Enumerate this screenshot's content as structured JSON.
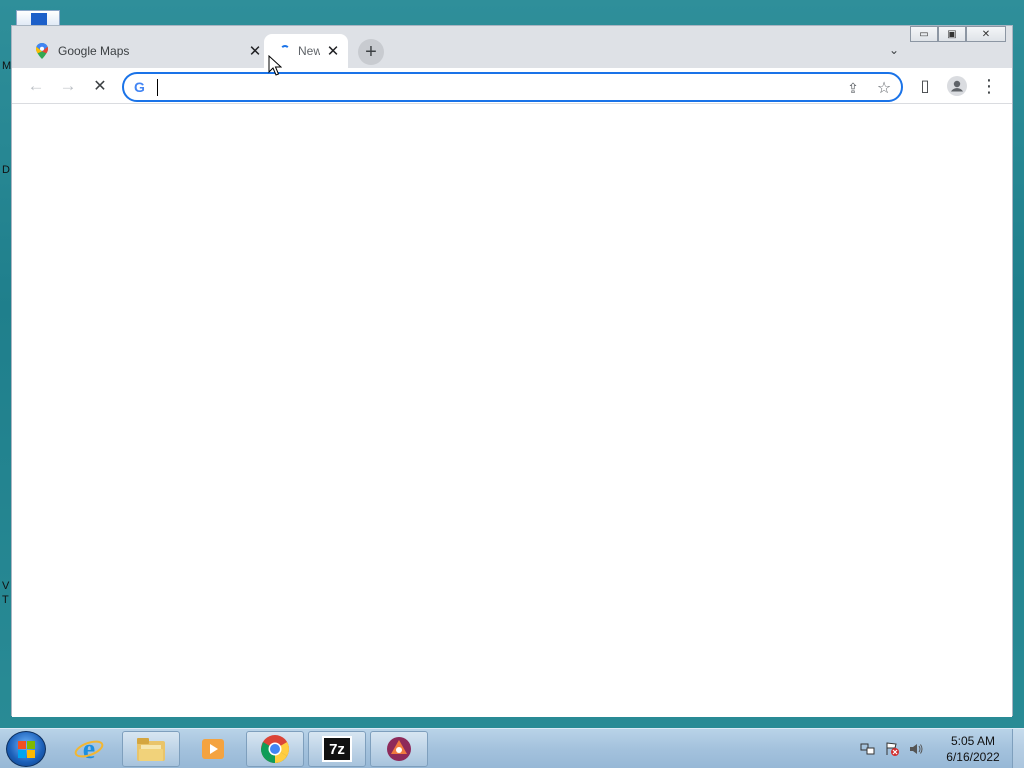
{
  "desktop": {
    "edge_letters": [
      "M",
      "D",
      "V",
      "T"
    ]
  },
  "browser": {
    "tabs": [
      {
        "label": "Google Maps",
        "icon": "maps-pin-icon",
        "active": false
      },
      {
        "label": "New Tab",
        "icon": "loading-spinner-icon",
        "active": true
      }
    ],
    "new_tab_symbol": "+",
    "tab_search_symbol": "⌄",
    "window_controls": {
      "minimize": "▭",
      "maximize": "▣",
      "close": "✕"
    },
    "toolbar": {
      "back": "←",
      "forward": "→",
      "stop": "✕"
    },
    "omnibox": {
      "g_letter": "G",
      "value": "",
      "placeholder": ""
    },
    "icons": {
      "share": "⇪",
      "bookmark": "☆",
      "side_panel": "▯",
      "profile": "●",
      "menu": "⋮"
    }
  },
  "taskbar": {
    "apps": [
      {
        "name": "internet-explorer",
        "icon": "ie-icon"
      },
      {
        "name": "file-explorer",
        "icon": "folder-icon"
      },
      {
        "name": "media-player",
        "icon": "media-icon"
      },
      {
        "name": "chrome",
        "icon": "chrome-icon"
      },
      {
        "name": "7zip",
        "icon": "7zip-icon",
        "label": "7z"
      },
      {
        "name": "app",
        "icon": "app-icon"
      }
    ],
    "clock": {
      "time": "5:05 AM",
      "date": "6/16/2022"
    }
  }
}
